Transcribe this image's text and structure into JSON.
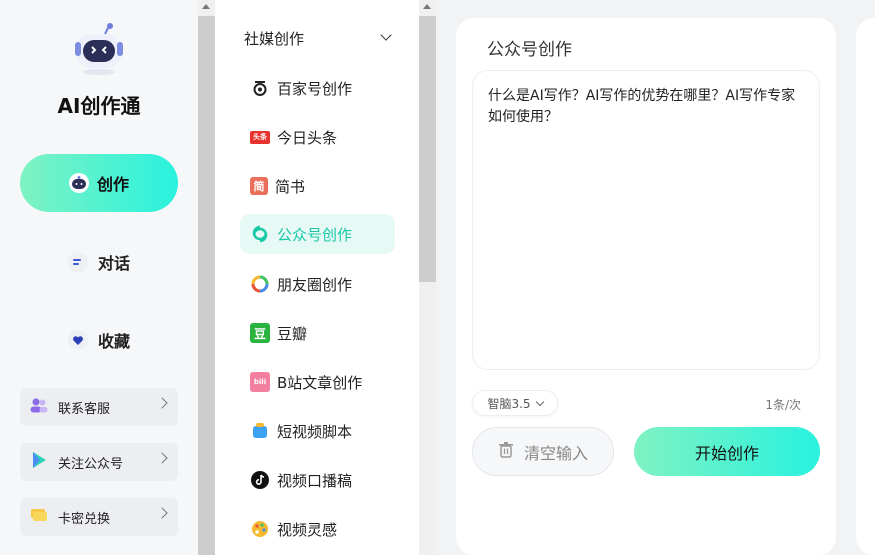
{
  "app": {
    "title": "AI创作通"
  },
  "nav": {
    "create": "创作",
    "chat": "对话",
    "favorites": "收藏"
  },
  "cards": {
    "service": "联系客服",
    "follow": "关注公众号",
    "redeem": "卡密兑换"
  },
  "category": {
    "header": "社媒创作",
    "items": [
      {
        "label": "百家号创作",
        "icon": "baijiahao-icon"
      },
      {
        "label": "今日头条",
        "icon": "toutiao-icon"
      },
      {
        "label": "简书",
        "icon": "jianshu-icon"
      },
      {
        "label": "公众号创作",
        "icon": "wechat-official-icon",
        "active": true
      },
      {
        "label": "朋友圈创作",
        "icon": "moments-icon"
      },
      {
        "label": "豆瓣",
        "icon": "douban-icon"
      },
      {
        "label": "B站文章创作",
        "icon": "bilibili-icon"
      },
      {
        "label": "短视频脚本",
        "icon": "short-video-icon"
      },
      {
        "label": "视频口播稿",
        "icon": "tiktok-icon"
      },
      {
        "label": "视频灵感",
        "icon": "palette-icon"
      }
    ],
    "toutiao_badge": "头条",
    "jianshu_badge": "简",
    "douban_badge": "豆",
    "bili_badge": "bili"
  },
  "panel": {
    "title": "公众号创作",
    "input_value": "什么是AI写作？AI写作的优势在哪里？AI写作专家如何使用？",
    "model": "智脑3.5",
    "quota": "1条/次",
    "clear_label": "清空输入",
    "start_label": "开始创作"
  },
  "colors": {
    "accent_start": "#7ff2c2",
    "accent_end": "#29f2de",
    "active_text": "#19c9a6"
  }
}
